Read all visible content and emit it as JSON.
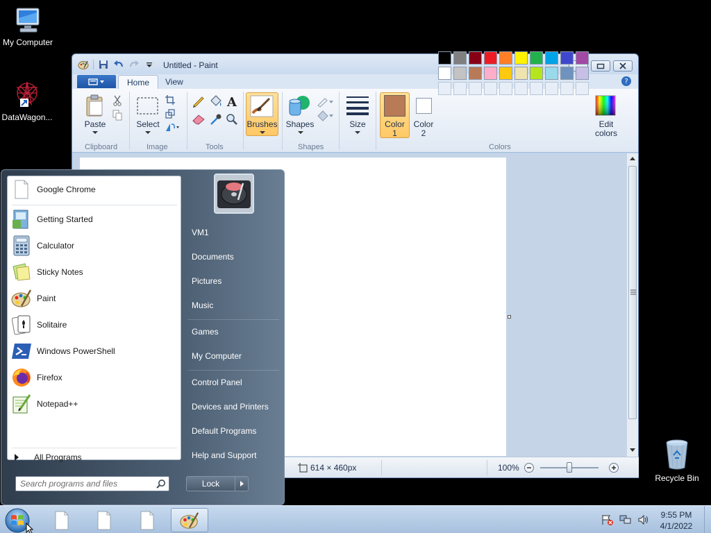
{
  "desktop": {
    "icons": [
      {
        "label": "My Computer",
        "icon": "computer-icon"
      },
      {
        "label": "DataWagon...",
        "icon": "datawagon-icon"
      },
      {
        "label": "Recycle Bin",
        "icon": "recycle-bin-icon"
      }
    ]
  },
  "paint": {
    "title": "Untitled - Paint",
    "tabs": [
      "Home",
      "View"
    ],
    "active_tab": "Home",
    "ribbon": {
      "paste_label": "Paste",
      "select_label": "Select",
      "brushes_label": "Brushes",
      "shapes_label": "Shapes",
      "size_label": "Size",
      "color1_label": "Color\n1",
      "color1_line1": "Color",
      "color1_line2": "1",
      "color2_line1": "Color",
      "color2_line2": "2",
      "edit_colors_line1": "Edit",
      "edit_colors_line2": "colors",
      "groups": [
        "Clipboard",
        "Image",
        "Tools",
        "Shapes",
        "Colors"
      ],
      "color1_value": "#b97a57",
      "color2_value": "#ffffff",
      "palette_row1": [
        "#000000",
        "#7f7f7f",
        "#880015",
        "#ed1c24",
        "#ff7f27",
        "#fff200",
        "#22b14c",
        "#00a2e8",
        "#3f48cc",
        "#a349a4"
      ],
      "palette_row2": [
        "#ffffff",
        "#c3c3c3",
        "#b97a57",
        "#ffaec9",
        "#ffc90e",
        "#efe4b0",
        "#b5e61d",
        "#99d9ea",
        "#7092be",
        "#c8bfe7"
      ]
    },
    "status": {
      "size": "614 × 460px",
      "zoom": "100%",
      "zoom_fraction": 0.5
    }
  },
  "start_menu": {
    "pinned": [
      {
        "name": "Google Chrome",
        "icon": "document-icon"
      },
      {
        "name": "Getting Started",
        "icon": "getting-started-icon"
      },
      {
        "name": "Calculator",
        "icon": "calculator-icon"
      },
      {
        "name": "Sticky Notes",
        "icon": "sticky-notes-icon"
      },
      {
        "name": "Paint",
        "icon": "paint-icon"
      },
      {
        "name": "Solitaire",
        "icon": "solitaire-icon"
      },
      {
        "name": "Windows PowerShell",
        "icon": "powershell-icon"
      },
      {
        "name": "Firefox",
        "icon": "firefox-icon"
      },
      {
        "name": "Notepad++",
        "icon": "notepadpp-icon"
      }
    ],
    "all_programs": "All Programs",
    "search_placeholder": "Search programs and files",
    "right": {
      "user": "VM1",
      "documents": "Documents",
      "pictures": "Pictures",
      "music": "Music",
      "games": "Games",
      "computer": "My Computer",
      "control_panel": "Control Panel",
      "devices": "Devices and Printers",
      "default_programs": "Default Programs",
      "help": "Help and Support"
    },
    "lock_label": "Lock"
  },
  "taskbar": {
    "time": "9:55 PM",
    "date": "4/1/2022"
  }
}
